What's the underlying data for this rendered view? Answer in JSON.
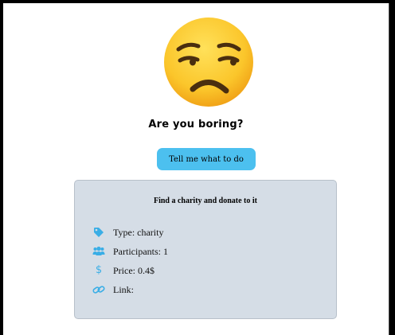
{
  "header": {
    "emoji_icon": "unamused-face-icon",
    "title": "Are you boring?",
    "cta_label": "Tell me what to do"
  },
  "activity": {
    "title": "Find a charity and donate to it",
    "type_text": "Type: charity",
    "participants_text": "Participants: 1",
    "price_text": "Price: 0.4$",
    "link_text": "Link:"
  },
  "icons": {
    "type": "tag-icon",
    "participants": "users-icon",
    "price": "dollar-icon",
    "link": "link-icon"
  },
  "colors": {
    "accent": "#4cc0ef",
    "card_background": "#d5dde6",
    "icon_color": "#3aaee6"
  }
}
